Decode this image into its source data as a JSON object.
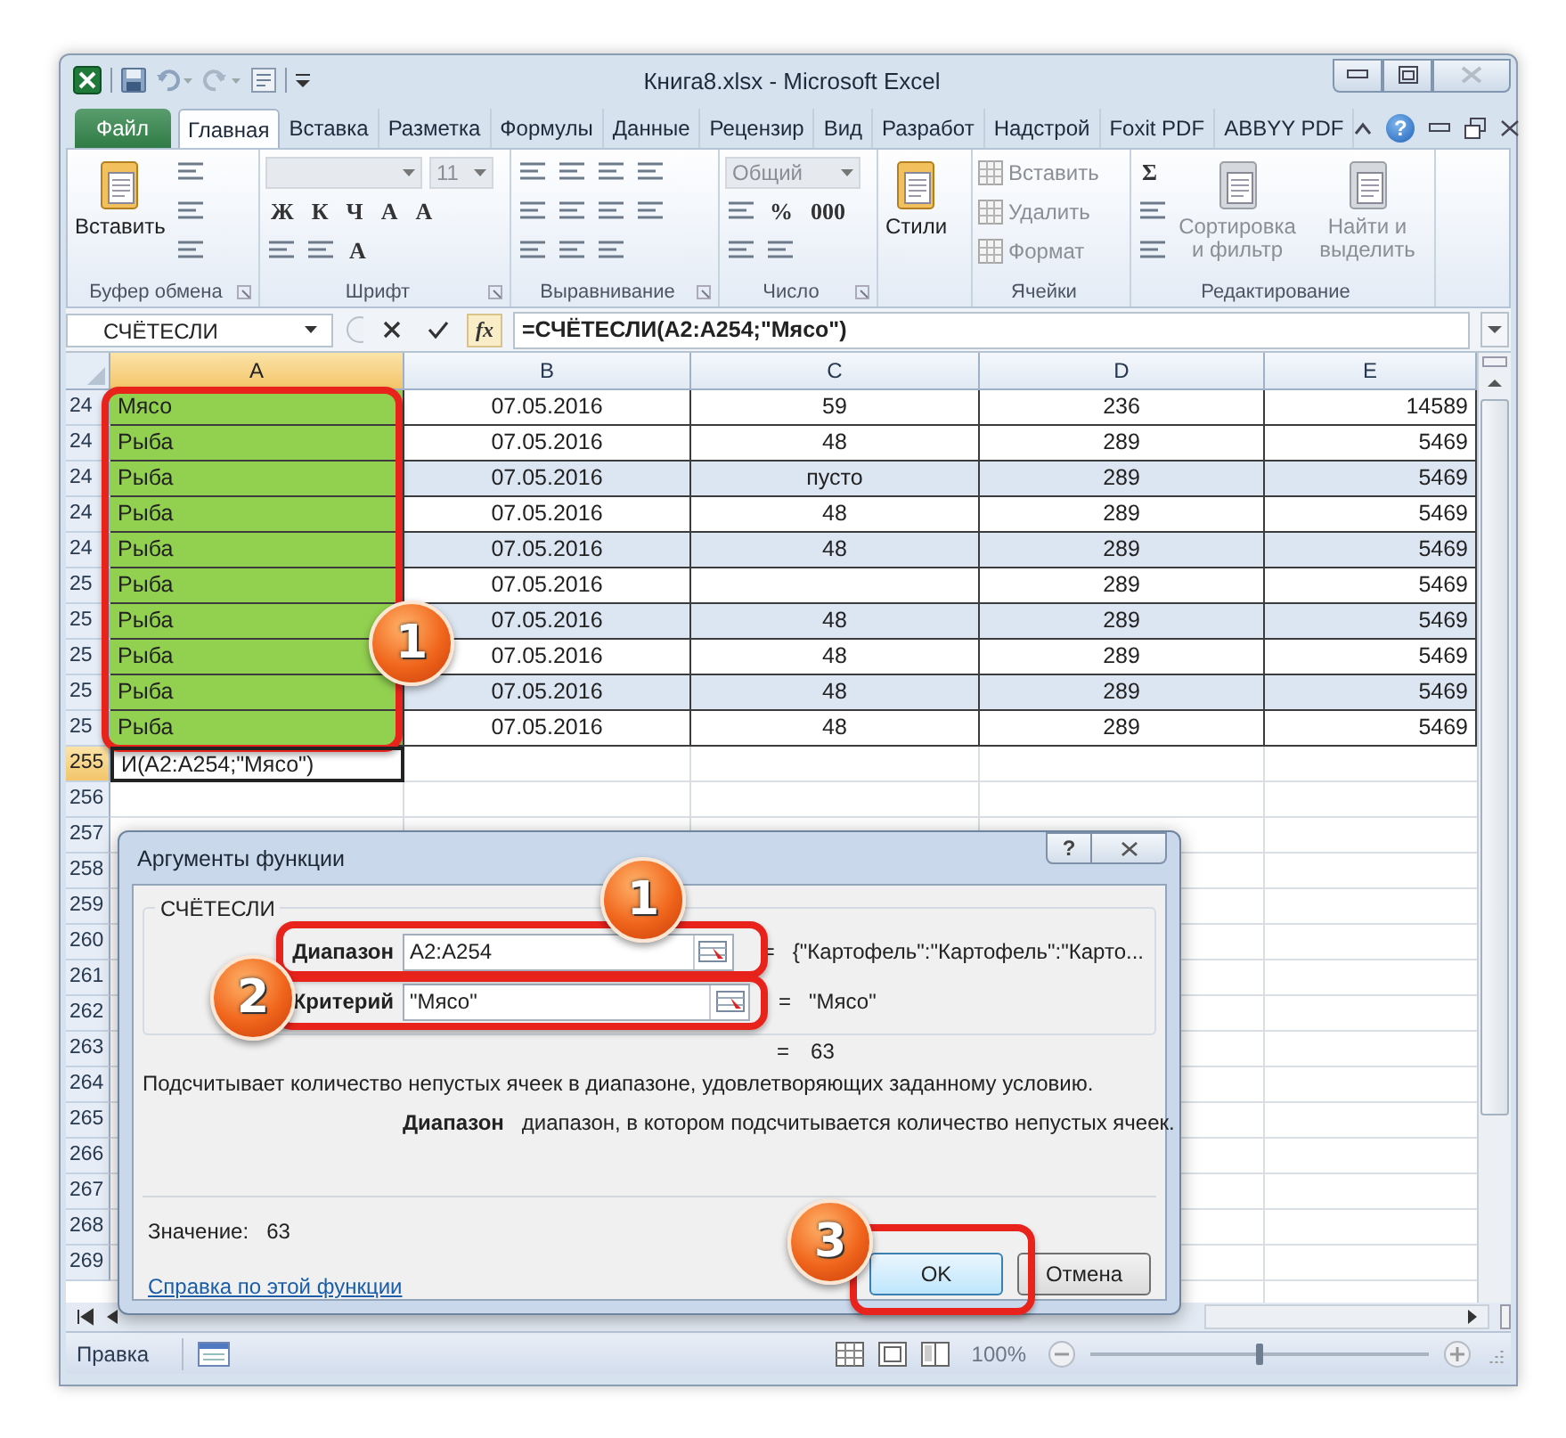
{
  "window": {
    "title": "Книга8.xlsx - Microsoft Excel",
    "help": "?"
  },
  "tabs": [
    {
      "label": "Файл",
      "kind": "file",
      "selected": false
    },
    {
      "label": "Главная",
      "kind": "tab",
      "selected": true
    },
    {
      "label": "Вставка",
      "kind": "tab",
      "selected": false
    },
    {
      "label": "Разметка",
      "kind": "tab",
      "selected": false
    },
    {
      "label": "Формулы",
      "kind": "tab",
      "selected": false
    },
    {
      "label": "Данные",
      "kind": "tab",
      "selected": false
    },
    {
      "label": "Рецензир",
      "kind": "tab",
      "selected": false
    },
    {
      "label": "Вид",
      "kind": "tab",
      "selected": false
    },
    {
      "label": "Разработ",
      "kind": "tab",
      "selected": false
    },
    {
      "label": "Надстрой",
      "kind": "tab",
      "selected": false
    },
    {
      "label": "Foxit PDF",
      "kind": "tab",
      "selected": false
    },
    {
      "label": "ABBYY PDF",
      "kind": "tab",
      "selected": false
    }
  ],
  "ribbon": {
    "groups": [
      {
        "label": "Буфер обмена",
        "launcher": true,
        "stacks": [
          [
            [
              {
                "kind": "large",
                "label": "Вставить",
                "disabled": false
              }
            ]
          ],
          [
            [
              {
                "kind": "icon"
              }
            ],
            [
              {
                "kind": "icon"
              }
            ],
            [
              {
                "kind": "icon"
              }
            ]
          ]
        ]
      },
      {
        "label": "Шрифт",
        "launcher": true,
        "stacks": [
          [
            [
              {
                "kind": "field",
                "disabled": true
              },
              {
                "kind": "field",
                "label": "11",
                "disabled": true
              }
            ],
            [
              {
                "kind": "glyph",
                "label": "Ж",
                "disabled": false
              },
              {
                "kind": "glyph",
                "label": "К",
                "disabled": false
              },
              {
                "kind": "glyph",
                "label": "Ч",
                "disabled": false
              },
              {
                "kind": "glyph",
                "label": "A",
                "disabled": false
              },
              {
                "kind": "glyph",
                "label": "A",
                "disabled": false
              }
            ],
            [
              {
                "kind": "icon"
              },
              {
                "kind": "icon"
              },
              {
                "kind": "glyph",
                "label": "A",
                "disabled": false
              }
            ]
          ]
        ]
      },
      {
        "label": "Выравнивание",
        "launcher": true,
        "stacks": [
          [
            [
              {
                "kind": "icon"
              },
              {
                "kind": "icon"
              },
              {
                "kind": "icon"
              },
              {
                "kind": "icon"
              }
            ],
            [
              {
                "kind": "icon"
              },
              {
                "kind": "icon"
              },
              {
                "kind": "icon"
              },
              {
                "kind": "icon"
              }
            ],
            [
              {
                "kind": "icon"
              },
              {
                "kind": "icon"
              },
              {
                "kind": "icon"
              }
            ]
          ]
        ]
      },
      {
        "label": "Число",
        "launcher": true,
        "stacks": [
          [
            [
              {
                "kind": "field",
                "label": "Общий",
                "disabled": true
              }
            ],
            [
              {
                "kind": "icon"
              },
              {
                "kind": "glyph",
                "label": "%",
                "disabled": false
              },
              {
                "kind": "glyph",
                "label": "000",
                "disabled": false
              }
            ],
            [
              {
                "kind": "icon"
              },
              {
                "kind": "icon"
              }
            ]
          ]
        ]
      },
      {
        "launcher": false,
        "stacks": [
          [
            [
              {
                "kind": "large",
                "label": "Стили",
                "disabled": false
              }
            ]
          ]
        ]
      },
      {
        "label": "Ячейки",
        "launcher": false,
        "stacks": [
          [
            [
              {
                "kind": "small",
                "label": "Вставить",
                "disabled": true
              }
            ],
            [
              {
                "kind": "small",
                "label": "Удалить",
                "disabled": true
              }
            ],
            [
              {
                "kind": "small",
                "label": "Формат",
                "disabled": true
              }
            ]
          ]
        ]
      },
      {
        "label": "Редактирование",
        "launcher": false,
        "stacks": [
          [
            [
              {
                "kind": "glyph",
                "label": "Σ",
                "disabled": false
              }
            ],
            [
              {
                "kind": "icon"
              }
            ],
            [
              {
                "kind": "icon"
              }
            ]
          ],
          [
            [
              {
                "kind": "large",
                "label": "Сортировка и фильтр",
                "disabled": true
              }
            ]
          ],
          [
            [
              {
                "kind": "large",
                "label": "Найти и выделить",
                "disabled": true
              }
            ]
          ]
        ]
      }
    ]
  },
  "formula_bar": {
    "name_box": "СЧЁТЕСЛИ",
    "fx": "fx",
    "formula": "=СЧЁТЕСЛИ(A2:A254;\"Мясо\")"
  },
  "sheet": {
    "columns": [
      {
        "label": "A",
        "selected": true
      },
      {
        "label": "B",
        "selected": false
      },
      {
        "label": "C",
        "selected": false
      },
      {
        "label": "D",
        "selected": false
      },
      {
        "label": "E",
        "selected": false
      }
    ],
    "rows": [
      {
        "header": "24",
        "kind": "table",
        "selected": false,
        "banded": false,
        "cells": [
          "Мясо",
          "07.05.2016",
          "59",
          "236",
          "14589"
        ]
      },
      {
        "header": "24",
        "kind": "table",
        "selected": false,
        "banded": false,
        "cells": [
          "Рыба",
          "07.05.2016",
          "48",
          "289",
          "5469"
        ]
      },
      {
        "header": "24",
        "kind": "table",
        "selected": false,
        "banded": true,
        "cells": [
          "Рыба",
          "07.05.2016",
          "пусто",
          "289",
          "5469"
        ]
      },
      {
        "header": "24",
        "kind": "table",
        "selected": false,
        "banded": false,
        "cells": [
          "Рыба",
          "07.05.2016",
          "48",
          "289",
          "5469"
        ]
      },
      {
        "header": "24",
        "kind": "table",
        "selected": false,
        "banded": true,
        "cells": [
          "Рыба",
          "07.05.2016",
          "48",
          "289",
          "5469"
        ]
      },
      {
        "header": "25",
        "kind": "table",
        "selected": false,
        "banded": false,
        "cells": [
          "Рыба",
          "07.05.2016",
          null,
          "289",
          "5469"
        ]
      },
      {
        "header": "25",
        "kind": "table",
        "selected": false,
        "banded": true,
        "cells": [
          "Рыба",
          "07.05.2016",
          "48",
          "289",
          "5469"
        ]
      },
      {
        "header": "25",
        "kind": "table",
        "selected": false,
        "banded": false,
        "cells": [
          "Рыба",
          "07.05.2016",
          "48",
          "289",
          "5469"
        ]
      },
      {
        "header": "25",
        "kind": "table",
        "selected": false,
        "banded": true,
        "cells": [
          "Рыба",
          "07.05.2016",
          "48",
          "289",
          "5469"
        ]
      },
      {
        "header": "25",
        "kind": "table",
        "selected": false,
        "banded": false,
        "cells": [
          "Рыба",
          "07.05.2016",
          "48",
          "289",
          "5469"
        ]
      },
      {
        "header": "255",
        "kind": "entry",
        "selected": true,
        "cells": [
          "И(A2:A254;\"Мясо\")"
        ]
      },
      {
        "header": "256",
        "kind": "empty",
        "selected": false
      },
      {
        "header": "257",
        "kind": "empty",
        "selected": false
      },
      {
        "header": "258",
        "kind": "empty",
        "selected": false
      },
      {
        "header": "259",
        "kind": "empty",
        "selected": false
      },
      {
        "header": "260",
        "kind": "empty",
        "selected": false
      },
      {
        "header": "261",
        "kind": "empty",
        "selected": false
      },
      {
        "header": "262",
        "kind": "empty",
        "selected": false
      },
      {
        "header": "263",
        "kind": "empty",
        "selected": false
      },
      {
        "header": "264",
        "kind": "empty",
        "selected": false
      },
      {
        "header": "265",
        "kind": "empty",
        "selected": false
      },
      {
        "header": "266",
        "kind": "empty",
        "selected": false
      },
      {
        "header": "267",
        "kind": "empty",
        "selected": false
      },
      {
        "header": "268",
        "kind": "empty",
        "selected": false
      },
      {
        "header": "269",
        "kind": "empty",
        "selected": false
      }
    ]
  },
  "dialog": {
    "title": "Аргументы функции",
    "help": "?",
    "function_name": "СЧЁТЕСЛИ",
    "arguments": [
      {
        "label": "Диапазон",
        "value": "A2:A254",
        "sign": "=",
        "result": "{\"Картофель\":\"Картофель\":\"Карто..."
      },
      {
        "label": "Критерий",
        "value": "\"Мясо\"",
        "sign": "=",
        "result": "\"Мясо\""
      }
    ],
    "result_sign": "=",
    "result": "63",
    "description": "Подсчитывает количество непустых ячеек в диапазоне, удовлетворяющих заданному условию.",
    "argument_help": {
      "label": "Диапазон",
      "text": "диапазон, в котором подсчитывается количество непустых ячеек."
    },
    "value_label": "Значение:",
    "value": "63",
    "help_link": "Справка по этой функции",
    "buttons": [
      {
        "label": "OK",
        "kind": "primary"
      },
      {
        "label": "Отмена",
        "kind": "secondary"
      }
    ]
  },
  "status_bar": {
    "mode": "Правка",
    "zoom": "100%",
    "zoom_slider": {
      "level": 0.5
    }
  },
  "annotations": [
    {
      "kind": "frame"
    },
    {
      "kind": "badge",
      "label": "1"
    },
    {
      "kind": "frame"
    },
    {
      "kind": "frame"
    },
    {
      "kind": "badge",
      "label": "1"
    },
    {
      "kind": "badge",
      "label": "2"
    },
    {
      "kind": "frame"
    },
    {
      "kind": "badge",
      "label": "3"
    }
  ]
}
